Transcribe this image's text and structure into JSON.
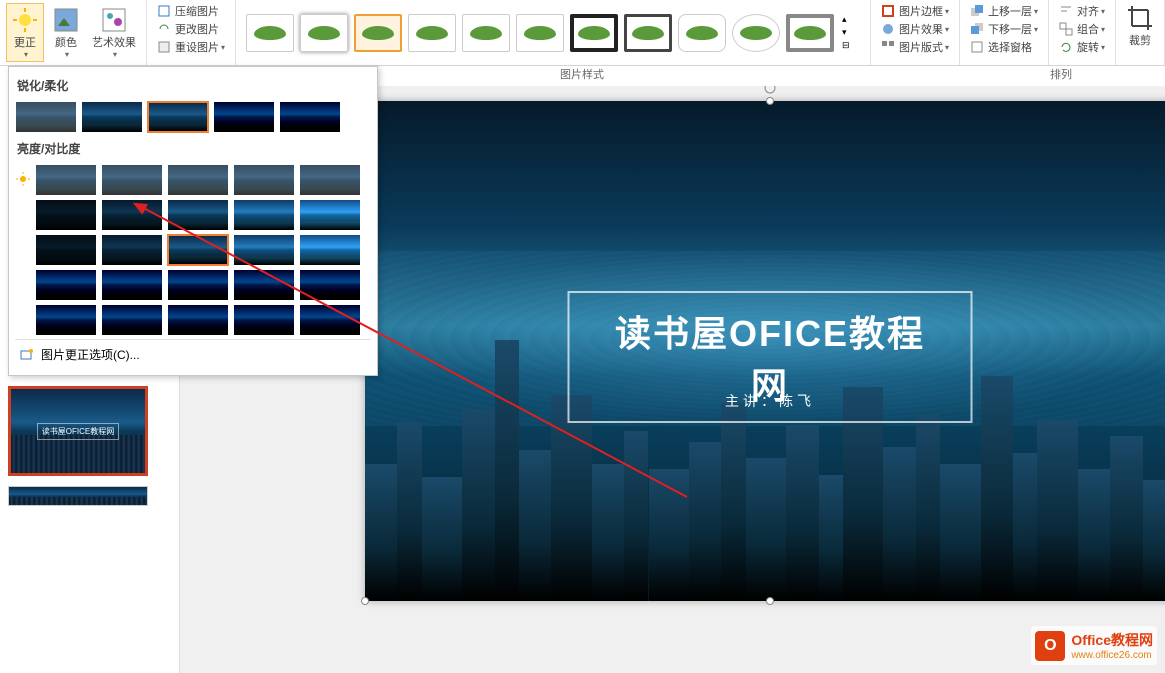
{
  "ribbon": {
    "corrections": "更正",
    "color": "颜色",
    "artistic": "艺术效果",
    "compress": "压缩图片",
    "change": "更改图片",
    "reset": "重设图片",
    "styles_label": "图片样式",
    "border": "图片边框",
    "effects": "图片效果",
    "layout": "图片版式",
    "bring_forward": "上移一层",
    "send_backward": "下移一层",
    "selection_pane": "选择窗格",
    "align": "对齐",
    "group": "组合",
    "rotate": "旋转",
    "arrange_label": "排列",
    "crop": "裁剪"
  },
  "dropdown": {
    "sharpen_soften": "锐化/柔化",
    "brightness_contrast": "亮度/对比度",
    "options": "图片更正选项(C)..."
  },
  "slide": {
    "title": "读书屋OFICE教程网",
    "subtitle": "主讲：陈飞",
    "thumb_title": "读书屋OFICE教程网"
  },
  "watermark": {
    "icon_letter": "O",
    "main": "Office教程网",
    "sub": "www.office26.com"
  }
}
